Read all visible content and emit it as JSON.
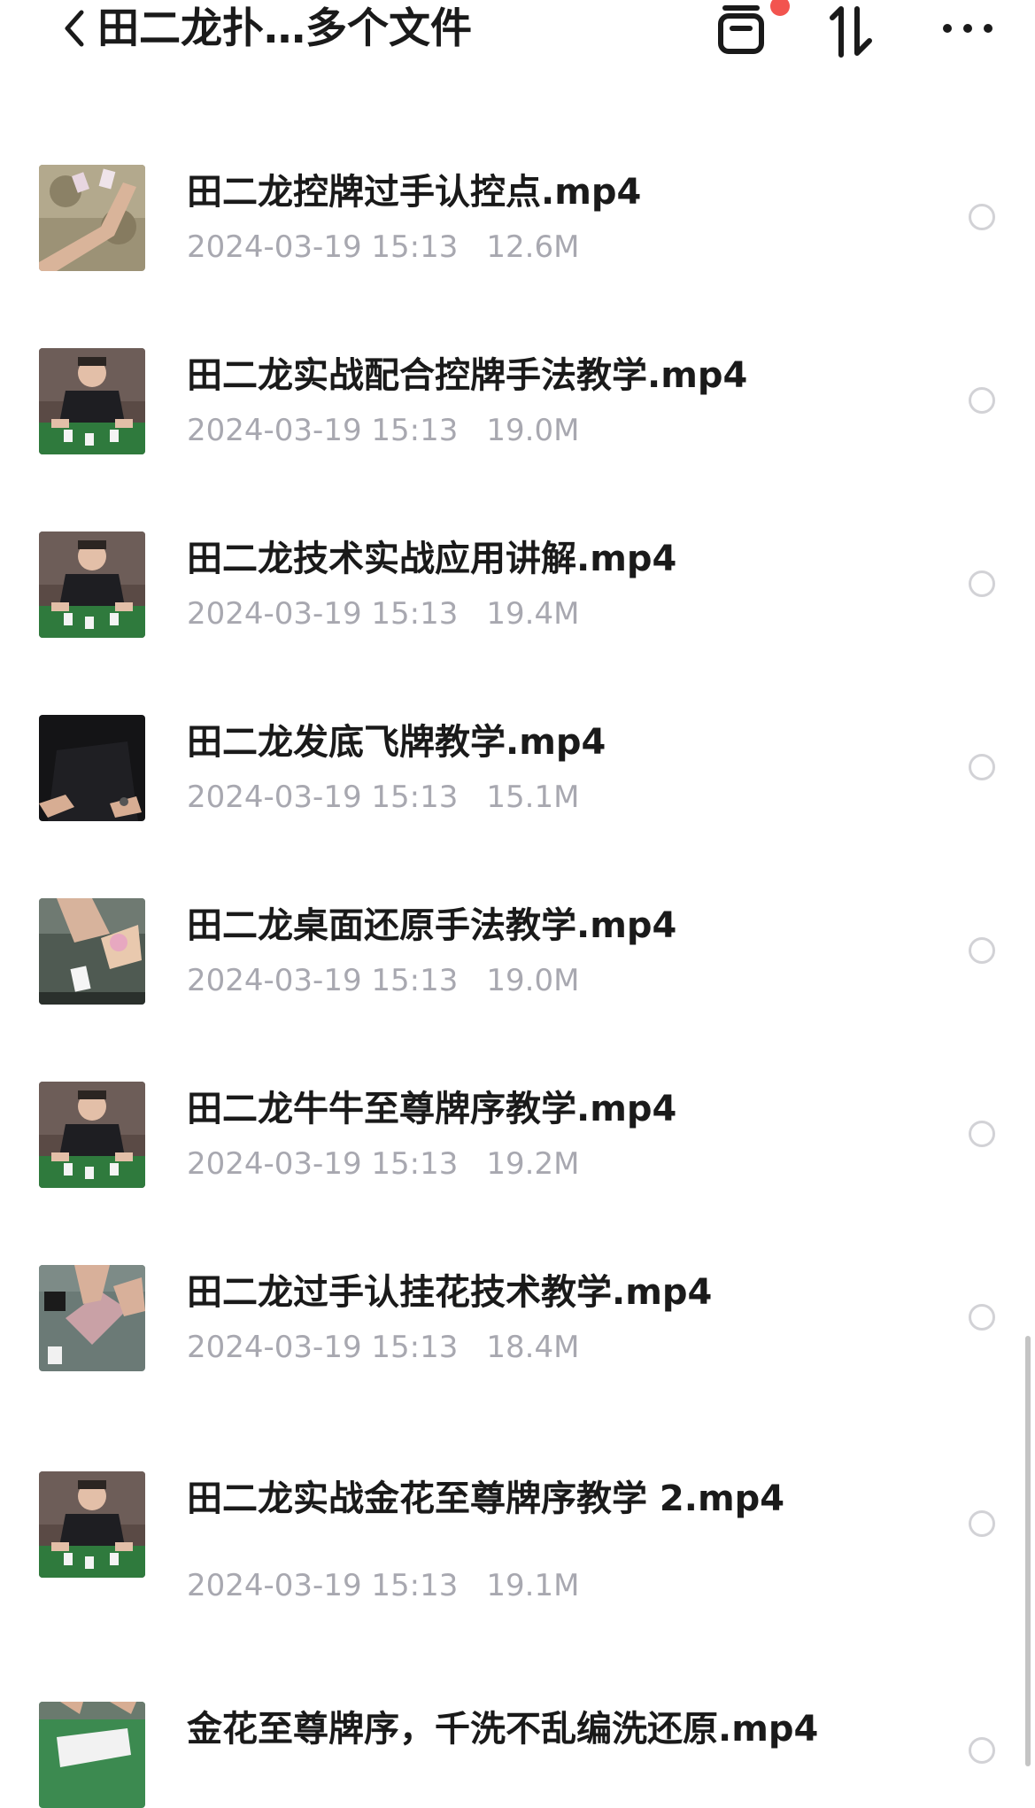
{
  "header": {
    "title": "田二龙扑…多个文件",
    "icons": {
      "back": "chevron-left-icon",
      "trash": "recycle-bin-icon",
      "sort": "sort-icon",
      "more": "more-icon"
    },
    "notification_dot_color": "#f2544f"
  },
  "files": [
    {
      "name": "田二龙控牌过手认控点.mp4",
      "date": "2024-03-19 15:13",
      "size": "12.6M",
      "thumb": "carpet"
    },
    {
      "name": "田二龙实战配合控牌手法教学.mp4",
      "date": "2024-03-19 15:13",
      "size": "19.0M",
      "thumb": "man-table"
    },
    {
      "name": "田二龙技术实战应用讲解.mp4",
      "date": "2024-03-19 15:13",
      "size": "19.4M",
      "thumb": "man-table"
    },
    {
      "name": "田二龙发底飞牌教学.mp4",
      "date": "2024-03-19 15:13",
      "size": "15.1M",
      "thumb": "dark-hands"
    },
    {
      "name": "田二龙桌面还原手法教学.mp4",
      "date": "2024-03-19 15:13",
      "size": "19.0M",
      "thumb": "cards-spread"
    },
    {
      "name": "田二龙牛牛至尊牌序教学.mp4",
      "date": "2024-03-19 15:13",
      "size": "19.2M",
      "thumb": "man-table"
    },
    {
      "name": "田二龙过手认挂花技术教学.mp4",
      "date": "2024-03-19 15:13",
      "size": "18.4M",
      "thumb": "grey-table"
    },
    {
      "name": "田二龙实战金花至尊牌序教学 2.mp4",
      "date": "2024-03-19 15:13",
      "size": "19.1M",
      "thumb": "man-table"
    },
    {
      "name": "金花至尊牌序，千洗不乱编洗还原.mp4",
      "date": "",
      "size": "",
      "thumb": "green-table"
    }
  ]
}
